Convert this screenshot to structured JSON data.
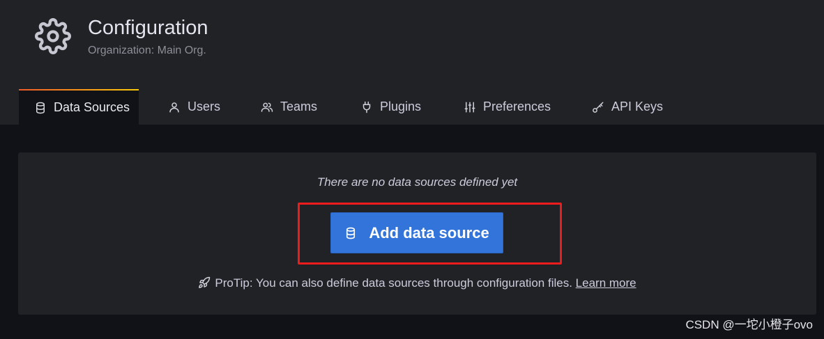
{
  "header": {
    "icon": "gear-icon",
    "title": "Configuration",
    "subtitle": "Organization: Main Org."
  },
  "tabs": [
    {
      "label": "Data Sources",
      "icon": "database-icon",
      "active": true
    },
    {
      "label": "Users",
      "icon": "user-icon",
      "active": false
    },
    {
      "label": "Teams",
      "icon": "users-icon",
      "active": false
    },
    {
      "label": "Plugins",
      "icon": "plug-icon",
      "active": false
    },
    {
      "label": "Preferences",
      "icon": "sliders-icon",
      "active": false
    },
    {
      "label": "API Keys",
      "icon": "key-icon",
      "active": false
    }
  ],
  "empty_state": {
    "message": "There are no data sources defined yet",
    "button_label": "Add data source",
    "button_icon": "database-icon",
    "protip_icon": "rocket-icon",
    "protip_text": "ProTip: You can also define data sources through configuration files.",
    "protip_link": "Learn more"
  },
  "watermark": "CSDN @一坨小橙子ovo",
  "colors": {
    "primary_button": "#3274d9",
    "active_tab_accent": "#f8902e",
    "highlight_box": "#ee1c1c"
  }
}
